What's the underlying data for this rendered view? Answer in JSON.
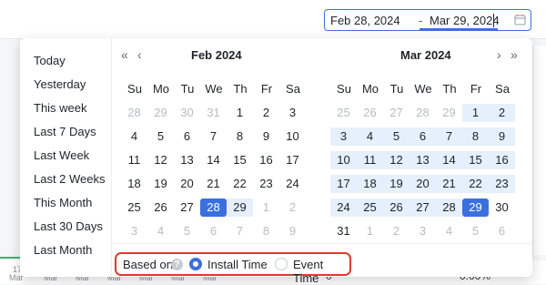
{
  "date_range": {
    "start": "Feb 28, 2024",
    "separator": "-",
    "end": "Mar 29, 2024"
  },
  "presets": [
    "Today",
    "Yesterday",
    "This week",
    "Last 7 Days",
    "Last Week",
    "Last 2 Weeks",
    "This Month",
    "Last 30 Days",
    "Last Month"
  ],
  "nav": {
    "prev_year": "«",
    "prev_month": "‹",
    "next_month": "›",
    "next_year": "»"
  },
  "weekdays": [
    "Su",
    "Mo",
    "Tu",
    "We",
    "Th",
    "Fr",
    "Sa"
  ],
  "calendars": [
    {
      "title": "Feb  2024",
      "weeks": [
        [
          {
            "d": "28",
            "s": "m"
          },
          {
            "d": "29",
            "s": "m"
          },
          {
            "d": "30",
            "s": "m"
          },
          {
            "d": "31",
            "s": "m"
          },
          {
            "d": "1"
          },
          {
            "d": "2"
          },
          {
            "d": "3"
          }
        ],
        [
          {
            "d": "4"
          },
          {
            "d": "5"
          },
          {
            "d": "6"
          },
          {
            "d": "7"
          },
          {
            "d": "8"
          },
          {
            "d": "9"
          },
          {
            "d": "10"
          }
        ],
        [
          {
            "d": "11"
          },
          {
            "d": "12"
          },
          {
            "d": "13"
          },
          {
            "d": "14"
          },
          {
            "d": "15"
          },
          {
            "d": "16"
          },
          {
            "d": "17"
          }
        ],
        [
          {
            "d": "18"
          },
          {
            "d": "19"
          },
          {
            "d": "20"
          },
          {
            "d": "21"
          },
          {
            "d": "22"
          },
          {
            "d": "23"
          },
          {
            "d": "24"
          }
        ],
        [
          {
            "d": "25"
          },
          {
            "d": "26"
          },
          {
            "d": "27"
          },
          {
            "d": "28",
            "s": "sel"
          },
          {
            "d": "29",
            "s": "r"
          },
          {
            "d": "1",
            "s": "m"
          },
          {
            "d": "2",
            "s": "m"
          }
        ],
        [
          {
            "d": "3",
            "s": "m"
          },
          {
            "d": "4",
            "s": "m"
          },
          {
            "d": "5",
            "s": "m"
          },
          {
            "d": "6",
            "s": "m"
          },
          {
            "d": "7",
            "s": "m"
          },
          {
            "d": "8",
            "s": "m"
          },
          {
            "d": "9",
            "s": "m"
          }
        ]
      ]
    },
    {
      "title": "Mar  2024",
      "weeks": [
        [
          {
            "d": "25",
            "s": "m"
          },
          {
            "d": "26",
            "s": "m"
          },
          {
            "d": "27",
            "s": "m"
          },
          {
            "d": "28",
            "s": "m"
          },
          {
            "d": "29",
            "s": "m"
          },
          {
            "d": "1",
            "s": "r"
          },
          {
            "d": "2",
            "s": "r"
          }
        ],
        [
          {
            "d": "3",
            "s": "r"
          },
          {
            "d": "4",
            "s": "r"
          },
          {
            "d": "5",
            "s": "r"
          },
          {
            "d": "6",
            "s": "r"
          },
          {
            "d": "7",
            "s": "r"
          },
          {
            "d": "8",
            "s": "r"
          },
          {
            "d": "9",
            "s": "r"
          }
        ],
        [
          {
            "d": "10",
            "s": "r"
          },
          {
            "d": "11",
            "s": "r"
          },
          {
            "d": "12",
            "s": "r"
          },
          {
            "d": "13",
            "s": "r"
          },
          {
            "d": "14",
            "s": "r"
          },
          {
            "d": "15",
            "s": "r"
          },
          {
            "d": "16",
            "s": "r"
          }
        ],
        [
          {
            "d": "17",
            "s": "r"
          },
          {
            "d": "18",
            "s": "r"
          },
          {
            "d": "19",
            "s": "r"
          },
          {
            "d": "20",
            "s": "r"
          },
          {
            "d": "21",
            "s": "r"
          },
          {
            "d": "22",
            "s": "r"
          },
          {
            "d": "23",
            "s": "r"
          }
        ],
        [
          {
            "d": "24",
            "s": "r"
          },
          {
            "d": "25",
            "s": "r"
          },
          {
            "d": "26",
            "s": "r"
          },
          {
            "d": "27",
            "s": "r"
          },
          {
            "d": "28",
            "s": "r"
          },
          {
            "d": "29",
            "s": "sel"
          },
          {
            "d": "30"
          }
        ],
        [
          {
            "d": "31"
          },
          {
            "d": "1",
            "s": "m"
          },
          {
            "d": "2",
            "s": "m"
          },
          {
            "d": "3",
            "s": "m"
          },
          {
            "d": "4",
            "s": "m"
          },
          {
            "d": "5",
            "s": "m"
          },
          {
            "d": "6",
            "s": "m"
          }
        ]
      ]
    }
  ],
  "based_on": {
    "label": "Based on:",
    "help": "?",
    "options": [
      {
        "label": "Install Time",
        "selected": true
      },
      {
        "label": "Event Time",
        "selected": false
      }
    ]
  },
  "background": {
    "axis_labels": [
      "17",
      "Mar",
      "Mar",
      "Mar",
      "Mar",
      "Mar",
      "Mar",
      "Mar",
      "Mar"
    ],
    "cell_value": "0",
    "percent_value": "0.00%"
  },
  "colors": {
    "accent": "#3a6fdd",
    "range": "#e6f0fc",
    "highlight_box": "#e03a2f"
  }
}
